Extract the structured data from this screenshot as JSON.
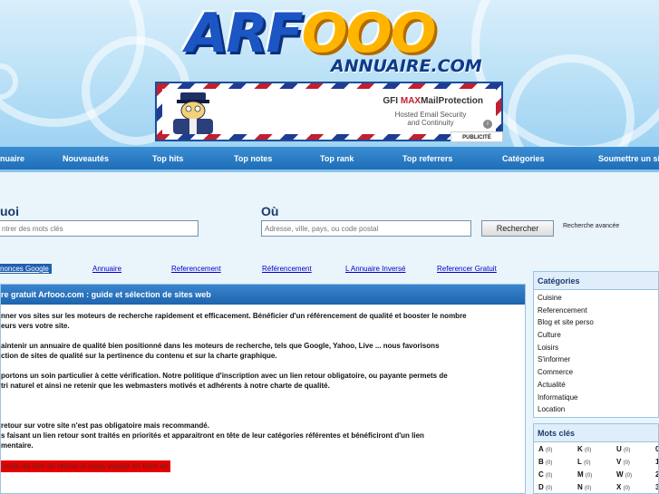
{
  "header": {
    "logo_main": "ARF",
    "logo_ooo": "OOO",
    "logo_sub": "ANNUAIRE.COM",
    "ad": {
      "brand_prefix": "GFI",
      "brand_max": "MAX",
      "brand_rest": "MailProtection",
      "line1": "Hosted Email Security",
      "line2": "and Continuity",
      "info_icon": "i",
      "publicity_label": "PUBLICITÉ"
    }
  },
  "nav": {
    "items": [
      "nuaire",
      "Nouveautés",
      "Top hits",
      "Top notes",
      "Top rank",
      "Top referrers",
      "Catégories",
      "Soumettre un si"
    ]
  },
  "search": {
    "what_label": "uoi",
    "what_placeholder": "ntrer des mots clés",
    "where_label": "Où",
    "where_placeholder": "Adresse, ville, pays, ou code postal",
    "button_label": "Rechercher",
    "advanced_label": "Recherche avancée"
  },
  "links": [
    "nonces Google",
    "Annuaire",
    "Referencement",
    "Référencement",
    "L Annuaire Inversé",
    "Referencer Gratuit"
  ],
  "main": {
    "title": "re gratuit Arfooo.com : guide et sélection de sites web",
    "lines": [
      "nner vos sites sur les moteurs de recherche rapidement et efficacement. Bénéficier d'un référencement de qualité et booster le nombre",
      "eurs vers votre site.",
      "aintenir un annuaire de qualité bien positionné dans les moteurs de recherche, tels que Google, Yahoo, Live ... nous favorisons",
      "ction de sites de qualité sur la pertinence du contenu et sur la charte graphique.",
      "portons un soin particulier à cette vérification. Notre politique d'inscription avec un lien retour obligatoire, ou payante permets de",
      "tri naturel et ainsi ne retenir que les webmasters motivés et adhérents à notre charte de qualité.",
      "retour sur votre site n'est pas obligatoire mais recommandé.",
      "s faisant un lien retour sont traités en priorités et apparaitront en tête de leur catégories référentes et bénéficiront d'un lien",
      "mentaire.",
      "code du lien de retour si vous voulez en faire un"
    ]
  },
  "categories": {
    "title": "Catégories",
    "items": [
      "Cuisine",
      "Referencement",
      "Blog et site perso",
      "Culture",
      "Loisirs",
      "S'informer",
      "Commerce",
      "Actualité",
      "Informatique",
      "Location"
    ]
  },
  "keywords": {
    "title": "Mots clés",
    "cells": [
      {
        "letter": "A",
        "count": "(0)"
      },
      {
        "letter": "K",
        "count": "(0)"
      },
      {
        "letter": "U",
        "count": "(0)"
      },
      {
        "letter": "0",
        "count": ""
      },
      {
        "letter": "B",
        "count": "(0)"
      },
      {
        "letter": "L",
        "count": "(0)"
      },
      {
        "letter": "V",
        "count": "(0)"
      },
      {
        "letter": "1",
        "count": ""
      },
      {
        "letter": "C",
        "count": "(0)"
      },
      {
        "letter": "M",
        "count": "(0)"
      },
      {
        "letter": "W",
        "count": "(0)"
      },
      {
        "letter": "2",
        "count": ""
      },
      {
        "letter": "D",
        "count": "(0)"
      },
      {
        "letter": "N",
        "count": "(0)"
      },
      {
        "letter": "X",
        "count": "(0)"
      },
      {
        "letter": "3",
        "count": ""
      }
    ]
  }
}
